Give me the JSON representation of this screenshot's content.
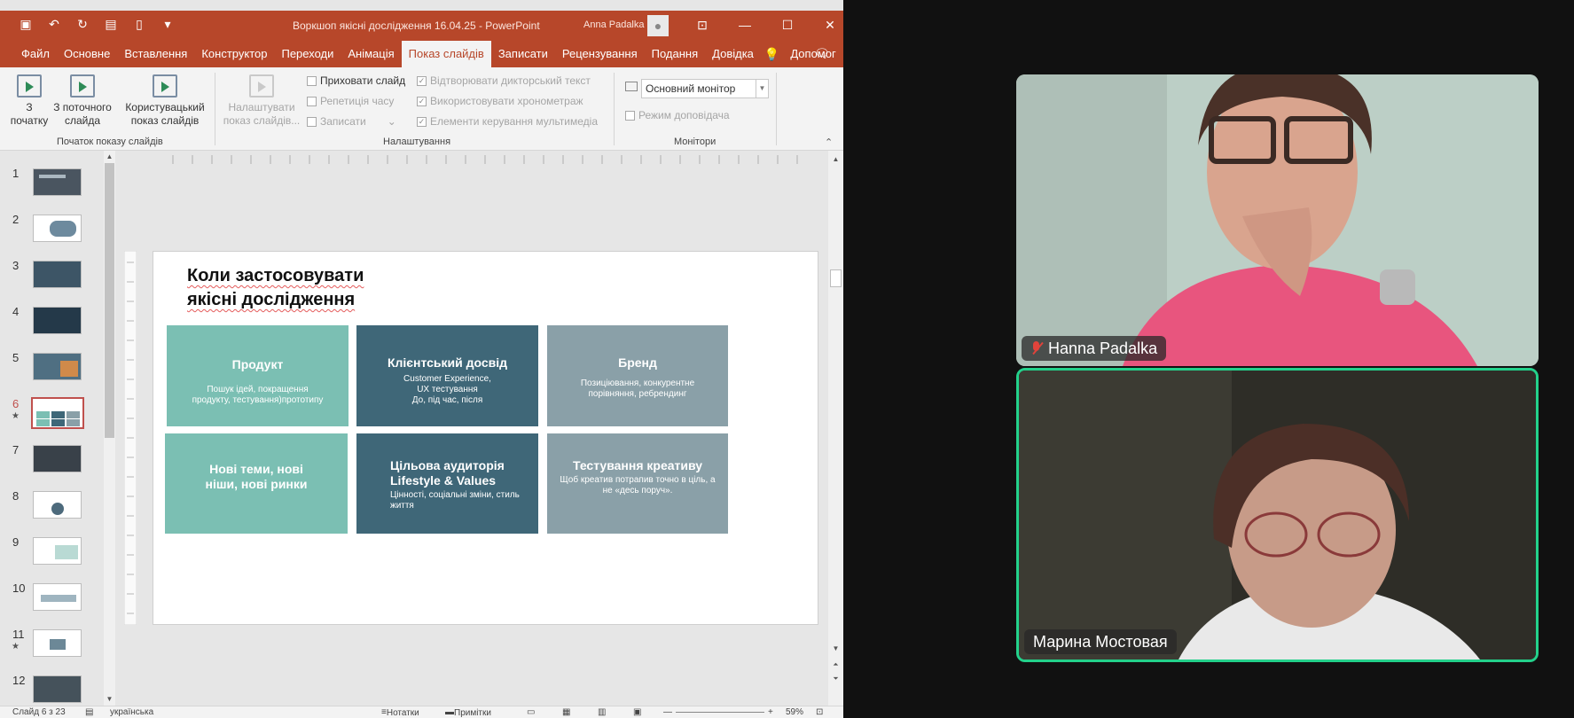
{
  "window": {
    "doc_title": "Воркшоп якісні дослідження 16.04.25  -  PowerPoint",
    "user_name": "Anna Padalka"
  },
  "tabs": [
    "Файл",
    "Основне",
    "Вставлення",
    "Конструктор",
    "Переходи",
    "Анімація",
    "Показ слайдів",
    "Записати",
    "Рецензування",
    "Подання",
    "Довідка",
    "Допомог"
  ],
  "active_tab": "Показ слайдів",
  "ribbon": {
    "from_start": "З початку",
    "from_current": "З поточного слайда",
    "custom_show": "Користувацький показ слайдів",
    "setup_show": "Налаштувати показ слайдів...",
    "hide_slide": "Приховати слайд",
    "rehearse": "Репетиція часу",
    "record": "Записати",
    "play_narration": "Відтворювати дикторський текст",
    "use_timings": "Використовувати хронометраж",
    "media_controls": "Елементи керування мультимедіа",
    "monitor_value": "Основний монітор",
    "presenter_view": "Режим доповідача",
    "group_start": "Початок показу слайдів",
    "group_setup": "Налаштування",
    "group_monitors": "Монітори"
  },
  "thumbnails": {
    "numbers": [
      "1",
      "2",
      "3",
      "4",
      "5",
      "6",
      "7",
      "8",
      "9",
      "10",
      "11",
      "12"
    ],
    "star": "★",
    "active": "6"
  },
  "slide": {
    "title": "Коли  застосовувати\nякісні дослідження",
    "cards": [
      {
        "title": "Продукт",
        "sub": "Пошук ідей, покращення продукту, тестування)прототипу"
      },
      {
        "title": "Клієнтський досвід",
        "sub": "Customer Experience, UX тестування\nДо, під час, після"
      },
      {
        "title": "Бренд",
        "sub": "Позиціювання, конкурентне порівняння, ребрендинг"
      },
      {
        "title": "Нові теми, нові ніши, нові ринки",
        "sub": ""
      },
      {
        "title": "Цільова аудиторія\nLifestyle & Values",
        "sub": "Цінності, соціальні зміни,  стиль життя"
      },
      {
        "title": "Тестування креативу",
        "sub": "Щоб креатив потрапив точно в ціль, а не «десь поруч»."
      }
    ],
    "colors": {
      "teal": "#7bbfb3",
      "dark": "#3f6778",
      "gray": "#8aa0a8"
    }
  },
  "statusbar": {
    "slide_info": "Слайд 6 з 23",
    "language": "українська",
    "notes": "Нотатки",
    "comments": "Примітки",
    "zoom": "59%"
  },
  "video": {
    "participant1": "Hanna Padalka",
    "participant2": "Марина Мостовая",
    "active_speaker_color": "#23d18b"
  },
  "brand_color": "#b7472a"
}
